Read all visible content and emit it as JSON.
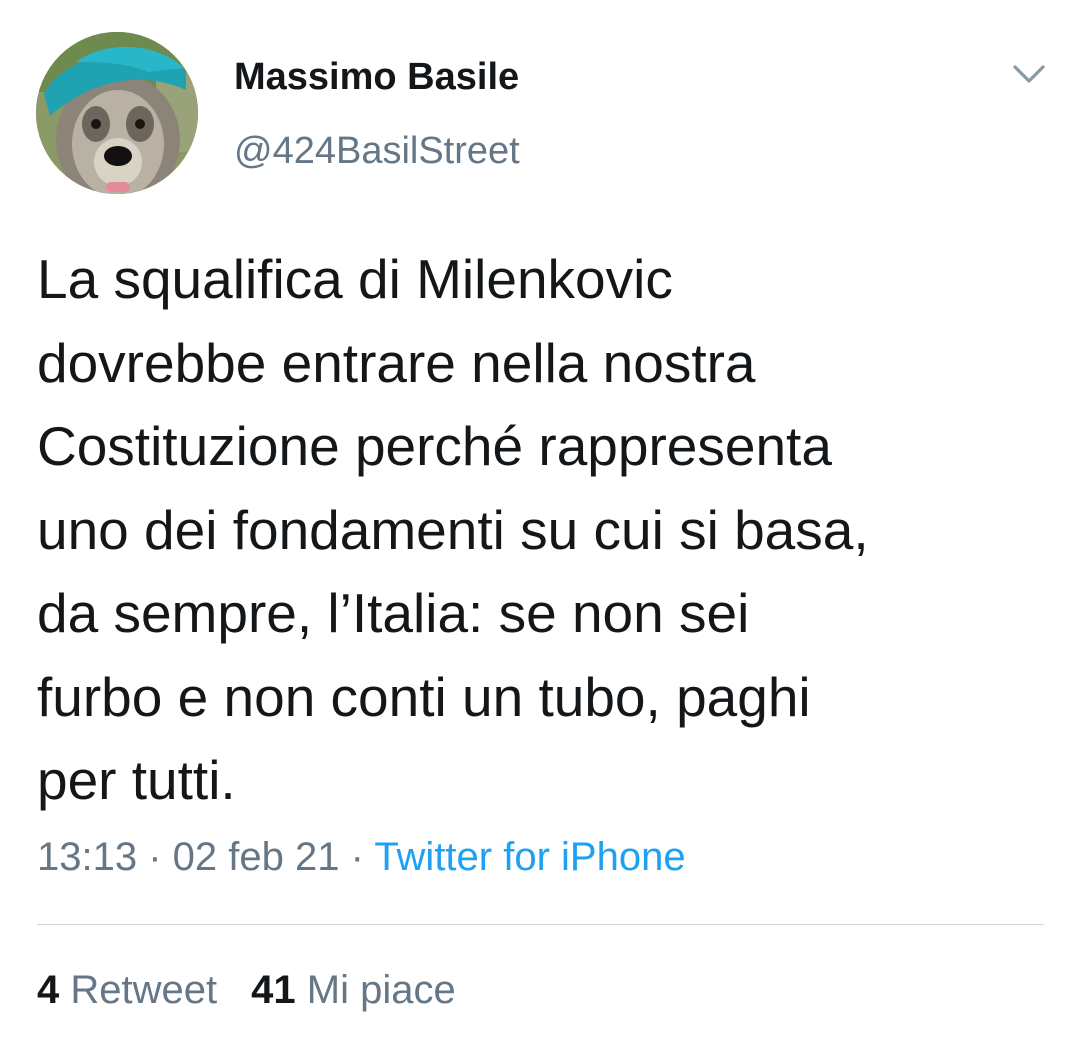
{
  "author": {
    "name": "Massimo Basile",
    "handle": "@424BasilStreet",
    "avatar": "dog-with-blue-cap-avatar"
  },
  "menu": {
    "icon": "chevron-down-icon"
  },
  "tweet": {
    "text": "La squalifica di Milenkovic\ndovrebbe entrare nella nostra\nCostituzione perché rappresenta\nuno dei fondamenti su cui si basa,\nda sempre, l’Italia: se non sei\nfurbo e non conti un tubo, paghi\nper tutti."
  },
  "meta": {
    "time": "13:13",
    "date": "02 feb 21",
    "separator": " · ",
    "source": "Twitter for iPhone"
  },
  "stats": {
    "retweets": {
      "count": "4",
      "label": "Retweet"
    },
    "likes": {
      "count": "41",
      "label": "Mi piace"
    }
  },
  "colors": {
    "text": "#14171a",
    "secondary": "#657786",
    "link": "#1da1f2",
    "divider": "#ccd6dd"
  }
}
